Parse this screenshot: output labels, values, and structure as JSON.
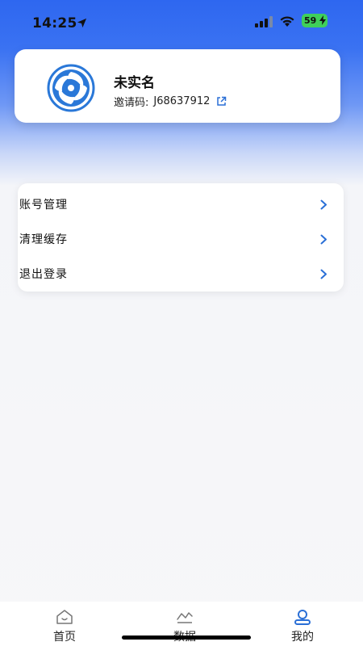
{
  "status_bar": {
    "time": "14:25",
    "battery": "59",
    "icons": [
      "location-arrow-icon",
      "signal-icon",
      "wifi-icon",
      "battery-charging-icon"
    ]
  },
  "profile": {
    "name": "未实名",
    "invite_label": "邀请码:",
    "invite_code": "J68637912",
    "avatar_icon": "swirl-logo-icon",
    "link_icon": "external-link-icon"
  },
  "menu": {
    "items": [
      {
        "label": "账号管理",
        "icon": "chevron-right-icon"
      },
      {
        "label": "清理缓存",
        "icon": "chevron-right-icon"
      },
      {
        "label": "退出登录",
        "icon": "chevron-right-icon"
      }
    ]
  },
  "tab_bar": {
    "tabs": [
      {
        "label": "首页",
        "icon": "home-icon"
      },
      {
        "label": "数据",
        "icon": "chart-line-icon"
      },
      {
        "label": "我的",
        "icon": "user-icon",
        "active": true
      }
    ]
  },
  "colors": {
    "header_blue": "#2e67f0",
    "accent": "#2a6fd6",
    "battery_green": "#3fcf5a"
  }
}
